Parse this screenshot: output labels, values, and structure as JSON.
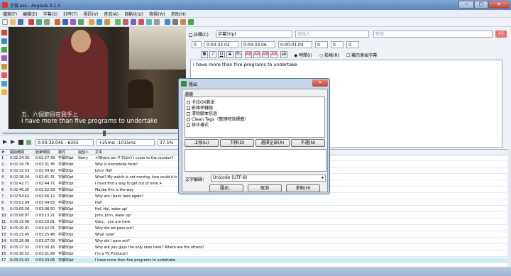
{
  "window": {
    "title": "字幕.ass - Aegisub 3.1.3",
    "min": "─",
    "max": "□",
    "close": "✕"
  },
  "menu": [
    "檔案(F)",
    "編輯(E)",
    "字幕(S)",
    "計時(T)",
    "視訊(V)",
    "音效(A)",
    "自動化(U)",
    "檢視(W)",
    "求助(H)"
  ],
  "video": {
    "sub_cn": "五、六個節目在我手上",
    "sub_en": "I have more than five programs to undertake",
    "time": "0:03:32.045 - 6355",
    "offset": "+25ms; -1015ms",
    "zoom": "37.5%"
  },
  "edit": {
    "comment_label": "註釋(C)",
    "style": "字幕50pt",
    "actor_placeholder": "說話人",
    "effect_placeholder": "特效",
    "char_count": "43",
    "layer": "0",
    "start": "0:03:32.02",
    "end": "0:03:33.06",
    "duration": "0:00:01.04",
    "margin_l": "0",
    "margin_r": "0",
    "margin_v": "0",
    "time_label": "時間(I)",
    "frame_label": "影格(R)",
    "show_original_label": "顯示原始字幕",
    "text": "I have more than five programs to undertake",
    "fmt": [
      "B",
      "I",
      "U",
      "S",
      "fn",
      "AB",
      "AB",
      "AB",
      "AB",
      "ab"
    ]
  },
  "grid": {
    "headers": [
      "#",
      "開始時間",
      "結束時間",
      "樣式",
      "說話人",
      "文本"
    ],
    "rows": [
      [
        "1",
        "0:02:24.39",
        "0:02:27.39",
        "字幕50pt",
        "Garry",
        "✳Where am I? Didn't I come to the reunion?"
      ],
      [
        "2",
        "0:02:29.76",
        "0:02:31.36",
        "字幕50pt",
        "",
        "Why is everybody here?"
      ],
      [
        "3",
        "0:02:32.53",
        "0:02:34.90",
        "字幕50pt",
        "",
        "John! Hal!"
      ],
      [
        "4",
        "0:02:38.24",
        "0:02:41.31",
        "字幕50pt",
        "",
        "What? My watch is not moving, how could it b"
      ],
      [
        "5",
        "0:02:42.71",
        "0:02:44.71",
        "字幕50pt",
        "",
        "I must find a way to get out of here.✳"
      ],
      [
        "6",
        "0:02:49.35",
        "0:02:52.58",
        "字幕50pt",
        "",
        "Maybe this is the way"
      ],
      [
        "7",
        "0:02:54.62",
        "0:02:56.12",
        "字幕50pt",
        "",
        "Why am I back here again?"
      ],
      [
        "8",
        "0:03:02.99",
        "0:03:04.83",
        "字幕50pt",
        "",
        "Hal!"
      ],
      [
        "9",
        "0:03:05.56",
        "0:03:08.50",
        "字幕50pt",
        "",
        "Hal, Hal, wake up!"
      ],
      [
        "10",
        "0:03:08.97",
        "0:03:13.21",
        "字幕50pt",
        "",
        "John, John, wake up!"
      ],
      [
        "11",
        "0:03:19.08",
        "0:03:20.81",
        "字幕50pt",
        "",
        "Gary... you are here"
      ],
      [
        "12",
        "0:03:20.91",
        "0:03:22.91",
        "字幕50pt",
        "",
        "Why did we pass out?"
      ],
      [
        "13",
        "0:03:23.45",
        "0:03:25.48",
        "字幕50pt",
        "",
        "What now?"
      ],
      [
        "14",
        "0:03:26.08",
        "0:03:27.09",
        "字幕50pt",
        "",
        "Why did I pass out?"
      ],
      [
        "15",
        "0:03:27.32",
        "0:03:30.16",
        "字幕50pt",
        "",
        "Why are you guys the only ones here? Where are the others?"
      ],
      [
        "16",
        "0:03:30.52",
        "0:03:31.69",
        "字幕50pt",
        "",
        "I'm a TV Producer!"
      ],
      [
        "17",
        "0:03:32.02",
        "0:03:33.06",
        "字幕50pt",
        "",
        "I have more than five programs to undertake"
      ]
    ]
  },
  "dialog": {
    "title": "匯出",
    "close": "✕",
    "group": "濾鏡",
    "filters": [
      "卡拉OK範本",
      "影格率轉換",
      "清除腳本信息",
      "Clean Tags（整理特效標籤）",
      "修正樣式"
    ],
    "btn_up": "上移(U)",
    "btn_down": "下移(D)",
    "btn_select_all": "選擇全部(A)",
    "btn_select_none": "不選(N)",
    "encoding_label": "文字編碼：",
    "encoding": "Unicode (UTF-8)",
    "btn_export": "匯出...",
    "btn_cancel": "取消",
    "btn_help": "求助(H)"
  }
}
